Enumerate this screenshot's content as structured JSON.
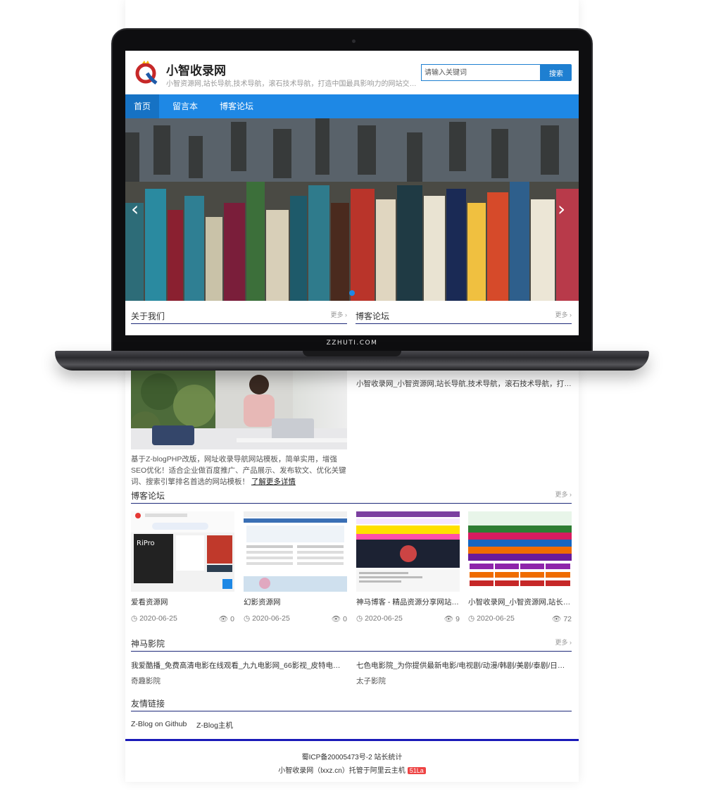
{
  "header": {
    "title": "小智收录网",
    "description": "小智资源网,站长导航,技术导航，滚石技术导航，打造中国最具影响力的网站交流和...",
    "search_placeholder": "请输入关键词",
    "search_button": "搜索"
  },
  "nav": {
    "items": [
      "首页",
      "留言本",
      "博客论坛"
    ],
    "active": "首页"
  },
  "sections_on_screen": {
    "about": {
      "title": "关于我们",
      "more": "更多 ›"
    },
    "blog": {
      "title": "博客论坛",
      "more": "更多 ›"
    }
  },
  "laptop_label": "ZZHUTI.COM",
  "about": {
    "text": "基于Z-blogPHP改版，网址收录导航网站模板，简单实用，增强SEO优化！适合企业做百度推广、产品展示、发布软文、优化关键词、搜索引擎排名首选的网站模板！",
    "link": "了解更多详情"
  },
  "about_side_item": "小智收录网_小智资源网,站长导航,技术导航，滚石技术导航，打造中国...",
  "blog": {
    "title": "博客论坛",
    "more": "更多 ›",
    "cards": [
      {
        "title": "爱看资源网",
        "date": "2020-06-25",
        "views": "0"
      },
      {
        "title": "幻影资源网",
        "date": "2020-06-25",
        "views": "0"
      },
      {
        "title": "神马博客 - 精品资源分享网站，...",
        "date": "2020-06-25",
        "views": "9"
      },
      {
        "title": "小智收录网_小智资源网,站长导...",
        "date": "2020-06-25",
        "views": "72"
      }
    ]
  },
  "movies": {
    "title": "神马影院",
    "more": "更多 ›",
    "items": [
      {
        "title": "我爱酷播_免费高清电影在线观看_九九电影网_66影视_皮特电影皮特影...",
        "sub": "奇趣影院"
      },
      {
        "title": "七色电影院_为你提供最新电影/电视剧/动漫/韩剧/美剧/泰剧/日剧/下...",
        "sub": "太子影院"
      }
    ]
  },
  "friends": {
    "title": "友情链接",
    "links": [
      "Z-Blog on Github",
      "Z-Blog主机"
    ]
  },
  "footer": {
    "icp": "蜀ICP备20005473号-2 站长统计",
    "host": "小智收录网（lxxz.cn）托管于阿里云主机",
    "badge": "51La"
  },
  "colors": {
    "accent": "#1e88e5",
    "footer_line": "#1a1ab8",
    "badge": "#ee4444"
  }
}
